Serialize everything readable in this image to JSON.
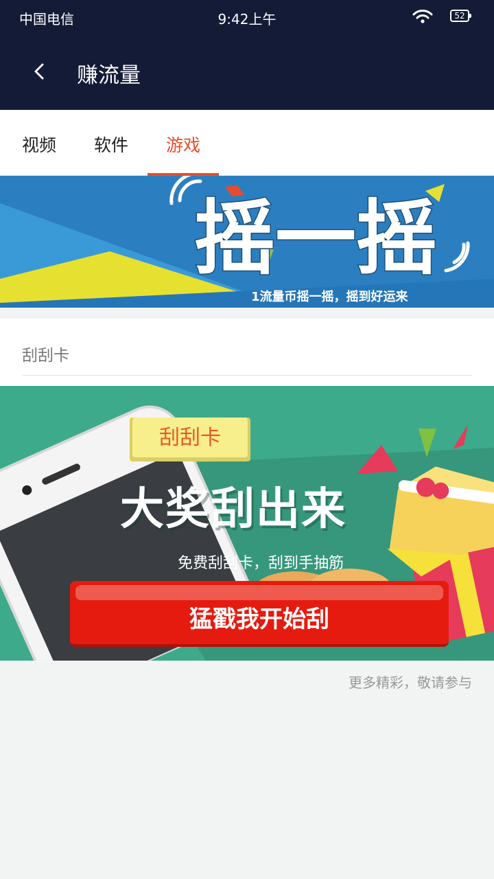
{
  "status_bar": {
    "carrier": "中国电信",
    "time": "9:42上午",
    "battery": "52"
  },
  "header": {
    "title": "赚流量"
  },
  "tabs": [
    {
      "label": "视频",
      "active": false
    },
    {
      "label": "软件",
      "active": false
    },
    {
      "label": "游戏",
      "active": true
    }
  ],
  "banner_shake": {
    "headline": "摇一摇",
    "caption": "1流量币摇一摇，摇到好运来"
  },
  "section": {
    "title": "刮刮卡"
  },
  "banner_scratch": {
    "tag": "刮刮卡",
    "headline": "大奖刮出来",
    "subtitle": "免费刮刮卡，刮到手抽筋",
    "button_label": "猛戳我开始刮"
  },
  "footer": {
    "note": "更多精彩，敬请参与"
  },
  "colors": {
    "header_bg": "#141b36",
    "accent": "#e84c2c",
    "scratch_bg": "#3daa8c",
    "button": "#e61b10"
  }
}
